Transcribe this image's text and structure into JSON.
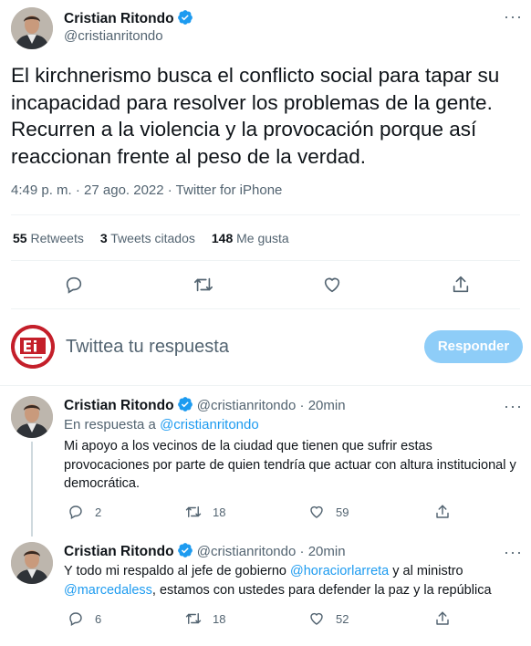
{
  "main_tweet": {
    "author_name": "Cristian Ritondo",
    "handle": "@cristianritondo",
    "text": "El kirchnerismo busca el conflicto social para tapar su incapacidad para resolver los problemas de la gente. Recurren a la violencia y la provocación porque así reaccionan frente al peso de la verdad.",
    "meta": "4:49 p. m. · 27 ago. 2022 · Twitter for iPhone",
    "stats": {
      "retweets_count": "55",
      "retweets_label": "Retweets",
      "quotes_count": "3",
      "quotes_label": "Tweets citados",
      "likes_count": "148",
      "likes_label": "Me gusta"
    }
  },
  "composer": {
    "placeholder": "Twittea tu respuesta",
    "button_label": "Responder",
    "avatar_text": "Ei"
  },
  "replies": [
    {
      "author_name": "Cristian Ritondo",
      "handle": "@cristianritondo",
      "time": "20min",
      "separator": "·",
      "in_reply_prefix": "En respuesta a",
      "in_reply_handle": "@cristianritondo",
      "text": "Mi apoyo a los vecinos de la ciudad que tienen que sufrir estas provocaciones por parte de quien tendría que actuar con altura institucional y democrática.",
      "reply_count": "2",
      "retweet_count": "18",
      "like_count": "59"
    },
    {
      "author_name": "Cristian Ritondo",
      "handle": "@cristianritondo",
      "time": "20min",
      "separator": "·",
      "text_part1": "Y todo mi respaldo al jefe de gobierno",
      "mention1": "@horaciorlarreta",
      "text_part2": "y al ministro",
      "mention2": "@marcedaless",
      "text_part3": ", estamos con ustedes para defender la paz y la república",
      "reply_count": "6",
      "retweet_count": "18",
      "like_count": "52"
    }
  ],
  "colors": {
    "verified_blue": "#1d9bf0",
    "link_blue": "#1d9bf0",
    "muted_gray": "#536471",
    "reply_button_disabled": "#8ecdf8",
    "logo_red": "#c41f2a"
  },
  "icons": [
    "verified-badge-icon",
    "more-icon",
    "reply-icon",
    "retweet-icon",
    "like-icon",
    "share-icon"
  ]
}
